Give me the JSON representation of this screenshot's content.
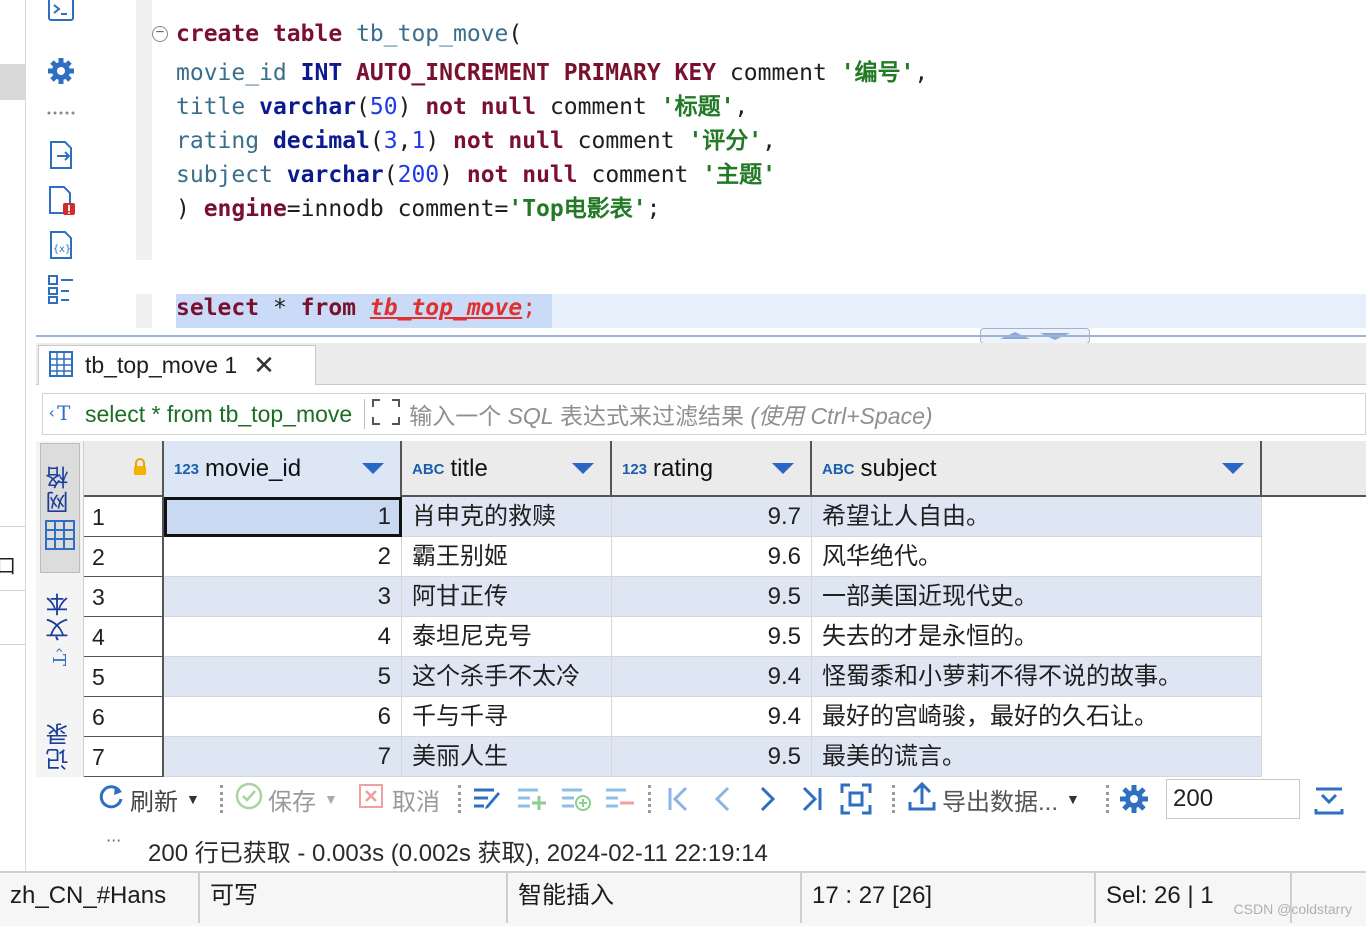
{
  "editor": {
    "lines": [
      [
        {
          "t": "create",
          "c": "kw"
        },
        {
          "t": " ",
          "c": ""
        },
        {
          "t": "table",
          "c": "kw"
        },
        {
          "t": " ",
          "c": ""
        },
        {
          "t": "tb_top_move",
          "c": "tbl"
        },
        {
          "t": "(",
          "c": ""
        }
      ],
      [
        {
          "t": "movie_id",
          "c": "id"
        },
        {
          "t": " ",
          "c": ""
        },
        {
          "t": "INT",
          "c": "kwb"
        },
        {
          "t": " ",
          "c": ""
        },
        {
          "t": "AUTO_INCREMENT PRIMARY KEY",
          "c": "kw"
        },
        {
          "t": " comment ",
          "c": ""
        },
        {
          "t": "'编号'",
          "c": "str"
        },
        {
          "t": ",",
          "c": ""
        }
      ],
      [
        {
          "t": "title",
          "c": "id"
        },
        {
          "t": " ",
          "c": ""
        },
        {
          "t": "varchar",
          "c": "kwb"
        },
        {
          "t": "(",
          "c": ""
        },
        {
          "t": "50",
          "c": "num"
        },
        {
          "t": ") ",
          "c": ""
        },
        {
          "t": "not null",
          "c": "kw"
        },
        {
          "t": " comment ",
          "c": ""
        },
        {
          "t": "'标题'",
          "c": "str"
        },
        {
          "t": ",",
          "c": ""
        }
      ],
      [
        {
          "t": "rating",
          "c": "id"
        },
        {
          "t": " ",
          "c": ""
        },
        {
          "t": "decimal",
          "c": "kwb"
        },
        {
          "t": "(",
          "c": ""
        },
        {
          "t": "3",
          "c": "num"
        },
        {
          "t": ",",
          "c": ""
        },
        {
          "t": "1",
          "c": "num"
        },
        {
          "t": ") ",
          "c": ""
        },
        {
          "t": "not null",
          "c": "kw"
        },
        {
          "t": " comment ",
          "c": ""
        },
        {
          "t": "'评分'",
          "c": "str"
        },
        {
          "t": ",",
          "c": ""
        }
      ],
      [
        {
          "t": "subject",
          "c": "id"
        },
        {
          "t": " ",
          "c": ""
        },
        {
          "t": "varchar",
          "c": "kwb"
        },
        {
          "t": "(",
          "c": ""
        },
        {
          "t": "200",
          "c": "num"
        },
        {
          "t": ") ",
          "c": ""
        },
        {
          "t": "not null",
          "c": "kw"
        },
        {
          "t": " comment ",
          "c": ""
        },
        {
          "t": "'主题'",
          "c": "str"
        }
      ],
      [
        {
          "t": ") ",
          "c": ""
        },
        {
          "t": "engine",
          "c": "kw"
        },
        {
          "t": "=innodb comment=",
          "c": ""
        },
        {
          "t": "'Top电影表'",
          "c": "str"
        },
        {
          "t": ";",
          "c": ""
        }
      ]
    ],
    "select_line": [
      {
        "t": "select",
        "c": "kw"
      },
      {
        "t": " * ",
        "c": ""
      },
      {
        "t": "from",
        "c": "kw"
      },
      {
        "t": " ",
        "c": ""
      },
      {
        "t": "tb_top_move",
        "c": "err"
      },
      {
        "t": ";",
        "c": "errplain"
      }
    ]
  },
  "results_tab": {
    "label": "tb_top_move 1",
    "close": "✕"
  },
  "filter": {
    "query_prefix": "select * from tb_top_move",
    "placeholder_a": "输入一个 ",
    "placeholder_b": "SQL",
    "placeholder_c": " 表达式来过滤结果 ",
    "placeholder_d": "(使用 Ctrl+Space)"
  },
  "side_tabs": {
    "grid": "网格",
    "text": "文本",
    "record": "记录"
  },
  "grid": {
    "columns": [
      {
        "type": "123",
        "name": "movie_id"
      },
      {
        "type": "ABC",
        "name": "title"
      },
      {
        "type": "123",
        "name": "rating"
      },
      {
        "type": "ABC",
        "name": "subject"
      }
    ],
    "rows": [
      {
        "n": "1",
        "movie_id": "1",
        "title": "肖申克的救赎",
        "rating": "9.7",
        "subject": "希望让人自由。"
      },
      {
        "n": "2",
        "movie_id": "2",
        "title": "霸王别姬",
        "rating": "9.6",
        "subject": "风华绝代。"
      },
      {
        "n": "3",
        "movie_id": "3",
        "title": "阿甘正传",
        "rating": "9.5",
        "subject": "一部美国近现代史。"
      },
      {
        "n": "4",
        "movie_id": "4",
        "title": "泰坦尼克号",
        "rating": "9.5",
        "subject": "失去的才是永恒的。"
      },
      {
        "n": "5",
        "movie_id": "5",
        "title": "这个杀手不太冷",
        "rating": "9.4",
        "subject": "怪蜀黍和小萝莉不得不说的故事。"
      },
      {
        "n": "6",
        "movie_id": "6",
        "title": "千与千寻",
        "rating": "9.4",
        "subject": "最好的宫崎骏，最好的久石让。"
      },
      {
        "n": "7",
        "movie_id": "7",
        "title": "美丽人生",
        "rating": "9.5",
        "subject": "最美的谎言。"
      }
    ]
  },
  "toolbar": {
    "refresh": "刷新",
    "save": "保存",
    "cancel": "取消",
    "export": "导出数据...",
    "fetch_size": "200",
    "cut_char": "2"
  },
  "result_status": {
    "dots": "···",
    "message": "200 行已获取 - 0.003s (0.002s 获取), 2024-02-11 22:19:14"
  },
  "status_bar": {
    "locale": "zh_CN_#Hans",
    "mode": "可写",
    "insert": "智能插入",
    "position": "17 : 27 [26]",
    "selection": "Sel: 26 | 1"
  },
  "watermark": "CSDN @coldstarry",
  "left_fragment": "口",
  "colors": {
    "accent": "#2a66c4",
    "keyword": "#7a1030",
    "string": "#237a26",
    "number": "#1f39e8",
    "row_alt": "#dfe6f3"
  }
}
